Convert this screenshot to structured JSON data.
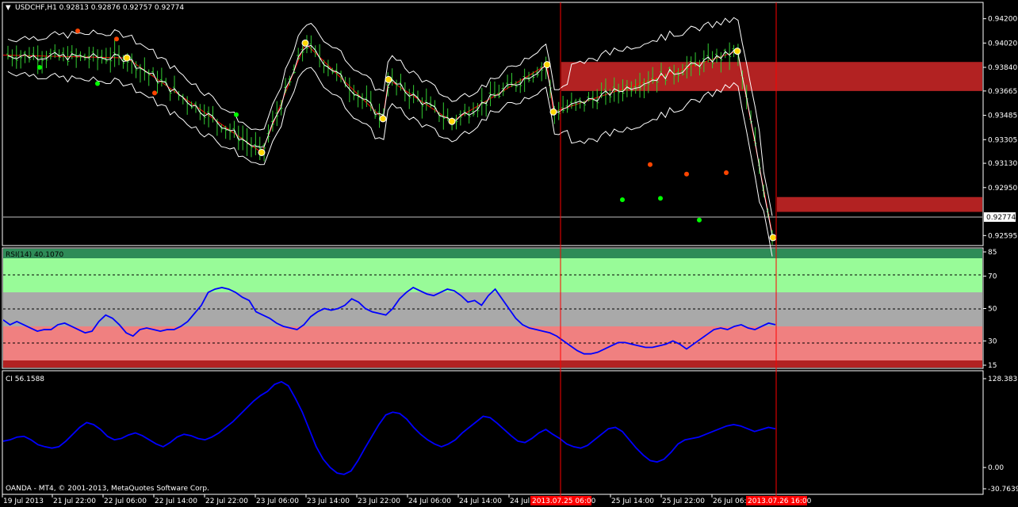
{
  "header": {
    "symbol_line": "USDCHF,H1  0.92813 0.92876 0.92757 0.92774",
    "menu_glyph": "▼"
  },
  "colors": {
    "candle": "#32cd32",
    "bollinger": "#ffffff",
    "zigzag": "#ff0000",
    "zone": "#b22222",
    "rsi_line": "#0000ff",
    "ci_line": "#0000ff",
    "vline": "#ff0000",
    "marker_high": "#ff4500",
    "marker_low": "#00ff00",
    "zigzag_point": "#ffd700"
  },
  "price_panel": {
    "current_price_label": "0.92774",
    "axis_labels": [
      "0.94200",
      "0.94020",
      "0.93840",
      "0.93665",
      "0.93485",
      "0.93305",
      "0.93130",
      "0.92950",
      "0.92595"
    ]
  },
  "rsi_panel": {
    "title": "RSI(14) 40.1070",
    "axis_labels": [
      "85",
      "70",
      "50",
      "30",
      "15"
    ]
  },
  "ci_panel": {
    "title": "CI  56.1588",
    "axis_labels": [
      "128.3831",
      "0.00",
      "-30.7639"
    ]
  },
  "footer": {
    "copyright": "OANDA - MT4, © 2001-2013, MetaQuotes Software Corp.",
    "time_labels": [
      "19 Jul 2013",
      "21 Jul 22:00",
      "22 Jul 06:00",
      "22 Jul 14:00",
      "22 Jul 22:00",
      "23 Jul 06:00",
      "23 Jul 14:00",
      "23 Jul 22:00",
      "24 Jul 06:00",
      "24 Jul 14:00",
      "24 Jul",
      "25 Jul 14:00",
      "25 Jul 22:00",
      "26 Jul 06:"
    ],
    "highlight_times": [
      "2013.07.25 06:00",
      "2013.07.26 16:00"
    ]
  },
  "chart_data": [
    {
      "type": "line",
      "panel": "price",
      "symbol": "USDCHF,H1",
      "ohlc": {
        "open": 0.92813,
        "high": 0.92876,
        "low": 0.92757,
        "close": 0.92774
      },
      "ylim": [
        0.9255,
        0.9428
      ],
      "zigzag_points": [
        0.9391,
        0.9321,
        0.9402,
        0.9346,
        0.9375,
        0.9344,
        0.9386,
        0.9351,
        0.9396,
        0.9258
      ],
      "resistance_zone": [
        0.93665,
        0.9388
      ],
      "support_zone": [
        0.9277,
        0.9288
      ]
    },
    {
      "type": "line",
      "panel": "rsi",
      "title": "RSI(14) 40.1070",
      "ylim": [
        15,
        85
      ],
      "levels": [
        70,
        50,
        30
      ],
      "series": [
        {
          "values": [
            43,
            40,
            42,
            40,
            38,
            36,
            37,
            37,
            40,
            41,
            39,
            37,
            35,
            36,
            42,
            46,
            44,
            40,
            35,
            33,
            37,
            38,
            37,
            36,
            37,
            37,
            39,
            42,
            47,
            52,
            60,
            62,
            63,
            62,
            60,
            57,
            55,
            48,
            46,
            44,
            41,
            39,
            38,
            37,
            40,
            45,
            48,
            50,
            49,
            50,
            52,
            56,
            54,
            50,
            48,
            47,
            46,
            50,
            56,
            60,
            63,
            61,
            59,
            58,
            60,
            62,
            61,
            58,
            54,
            55,
            52,
            58,
            62,
            56,
            50,
            44,
            40,
            38,
            37,
            36,
            35,
            33,
            30,
            27,
            24,
            22,
            22,
            23,
            25,
            27,
            29,
            29,
            28,
            27,
            26,
            26,
            27,
            28,
            30,
            28,
            25,
            28,
            31,
            34,
            37,
            38,
            37,
            39,
            40,
            38,
            37,
            39,
            41,
            40
          ]
        }
      ]
    },
    {
      "type": "line",
      "panel": "ci",
      "title": "CI  56.1588",
      "ylim": [
        -30.7639,
        128.3831
      ],
      "series": [
        {
          "values": [
            38,
            40,
            44,
            45,
            40,
            33,
            30,
            28,
            30,
            38,
            48,
            58,
            65,
            62,
            55,
            45,
            40,
            42,
            47,
            50,
            46,
            40,
            34,
            30,
            36,
            44,
            48,
            46,
            42,
            40,
            44,
            50,
            58,
            66,
            76,
            86,
            96,
            104,
            110,
            120,
            124,
            118,
            100,
            80,
            55,
            30,
            12,
            0,
            -8,
            -10,
            -5,
            10,
            28,
            45,
            62,
            76,
            80,
            78,
            70,
            58,
            48,
            40,
            34,
            30,
            34,
            40,
            50,
            58,
            66,
            74,
            72,
            64,
            55,
            46,
            38,
            36,
            42,
            50,
            55,
            48,
            42,
            34,
            30,
            28,
            32,
            40,
            48,
            56,
            58,
            52,
            40,
            28,
            18,
            10,
            8,
            12,
            22,
            34,
            40,
            42,
            44,
            48,
            52,
            56,
            60,
            62,
            60,
            56,
            52,
            55,
            58,
            56
          ]
        }
      ]
    }
  ]
}
